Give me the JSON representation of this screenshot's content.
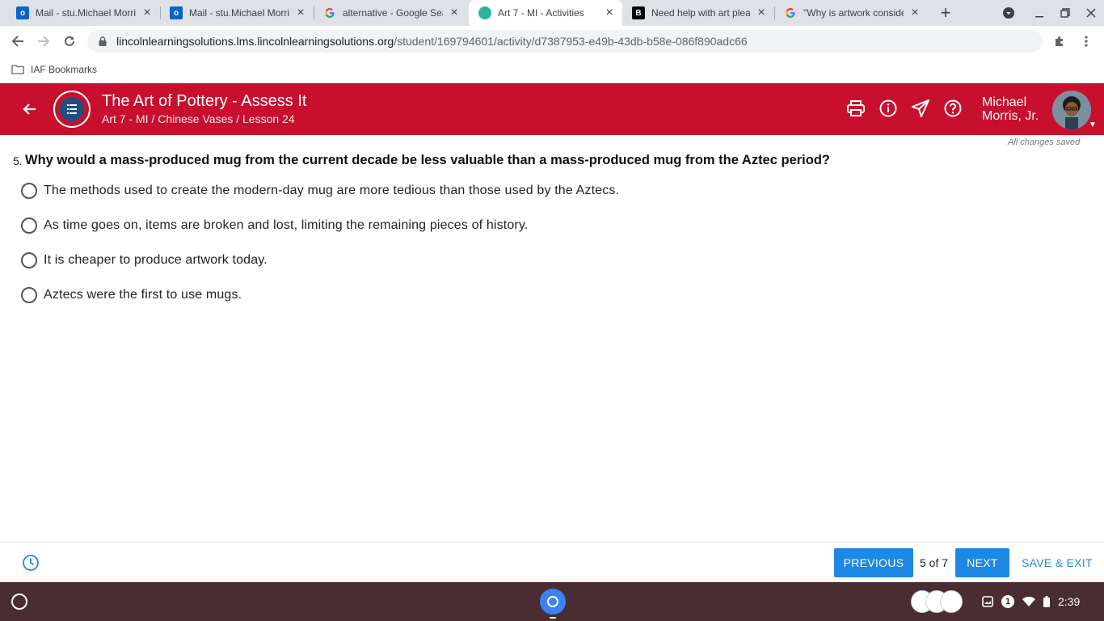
{
  "browser": {
    "tabs": [
      {
        "title": "Mail - stu.Michael Morris",
        "icon": "outlook-icon"
      },
      {
        "title": "Mail - stu.Michael Morris",
        "icon": "outlook-icon"
      },
      {
        "title": "alternative - Google Search",
        "icon": "google-icon"
      },
      {
        "title": "Art 7 - MI - Activities",
        "icon": "lms-icon",
        "active": true
      },
      {
        "title": "Need help with art please",
        "icon": "brainly-icon"
      },
      {
        "title": "\"Why is artwork considered",
        "icon": "google-icon"
      }
    ],
    "url_host": "lincolnlearningsolutions.lms.lincolnlearningsolutions.org",
    "url_path": "/student/169794601/activity/d7387953-e49b-43db-b58e-086f890adc66",
    "bookmark": "IAF Bookmarks"
  },
  "header": {
    "title": "The Art of Pottery - Assess It",
    "breadcrumb": "Art 7 - MI / Chinese Vases / Lesson 24",
    "user_name_line1": "Michael",
    "user_name_line2": "Morris, Jr.",
    "accent_color": "#c8102e",
    "icons": [
      "print-icon",
      "info-icon",
      "send-icon",
      "help-icon"
    ]
  },
  "status": {
    "saved": "All changes saved"
  },
  "question": {
    "number": "5.",
    "text": "Why would a mass-produced mug from the current decade be less valuable than a mass-produced mug from the Aztec period?",
    "options": [
      {
        "label": "The methods used to create the modern-day mug are more tedious than those used by the Aztecs.",
        "selected": false
      },
      {
        "label": "As time goes on, items are broken and lost, limiting the remaining pieces of history.",
        "selected": false
      },
      {
        "label": "It is cheaper to produce artwork today.",
        "selected": false
      },
      {
        "label": "Aztecs were the first to use mugs.",
        "selected": false
      }
    ]
  },
  "footer": {
    "previous": "PREVIOUS",
    "page": "5 of 7",
    "next": "NEXT",
    "save_exit": "SAVE & EXIT",
    "button_color": "#1e88e5"
  },
  "shelf": {
    "notification_count": "1",
    "time": "2:39"
  }
}
